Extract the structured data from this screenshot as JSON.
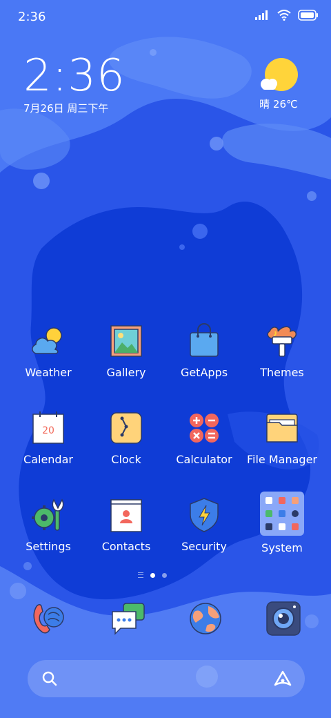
{
  "status_bar": {
    "time": "2:36",
    "icons": [
      "signal-icon",
      "wifi-icon",
      "battery-icon"
    ]
  },
  "clock_widget": {
    "time": "2:36",
    "date": "7月26日 周三下午"
  },
  "weather_widget": {
    "text": "晴 26℃",
    "icon": "sun-cloud-icon"
  },
  "apps": [
    {
      "label": "Weather",
      "icon": "weather-icon"
    },
    {
      "label": "Gallery",
      "icon": "gallery-icon"
    },
    {
      "label": "GetApps",
      "icon": "getapps-icon"
    },
    {
      "label": "Themes",
      "icon": "themes-icon"
    },
    {
      "label": "Calendar",
      "icon": "calendar-icon",
      "badge": "20"
    },
    {
      "label": "Clock",
      "icon": "clock-icon"
    },
    {
      "label": "Calculator",
      "icon": "calculator-icon"
    },
    {
      "label": "File Manager",
      "icon": "file-manager-icon"
    },
    {
      "label": "Settings",
      "icon": "settings-icon"
    },
    {
      "label": "Contacts",
      "icon": "contacts-icon"
    },
    {
      "label": "Security",
      "icon": "security-icon"
    },
    {
      "label": "System",
      "icon": "system-folder-icon"
    }
  ],
  "page_indicator": {
    "pages": 2,
    "active": 1
  },
  "dock": [
    "phone-icon",
    "messages-icon",
    "browser-icon",
    "camera-icon"
  ],
  "search_bar": {
    "left_icon": "search-icon",
    "right_icon": "assistant-icon"
  },
  "colors": {
    "wallpaper_light": "#4a78f5",
    "wallpaper_mid": "#2450e6",
    "wallpaper_deep": "#0f3cd6",
    "sun": "#ffd43a"
  }
}
